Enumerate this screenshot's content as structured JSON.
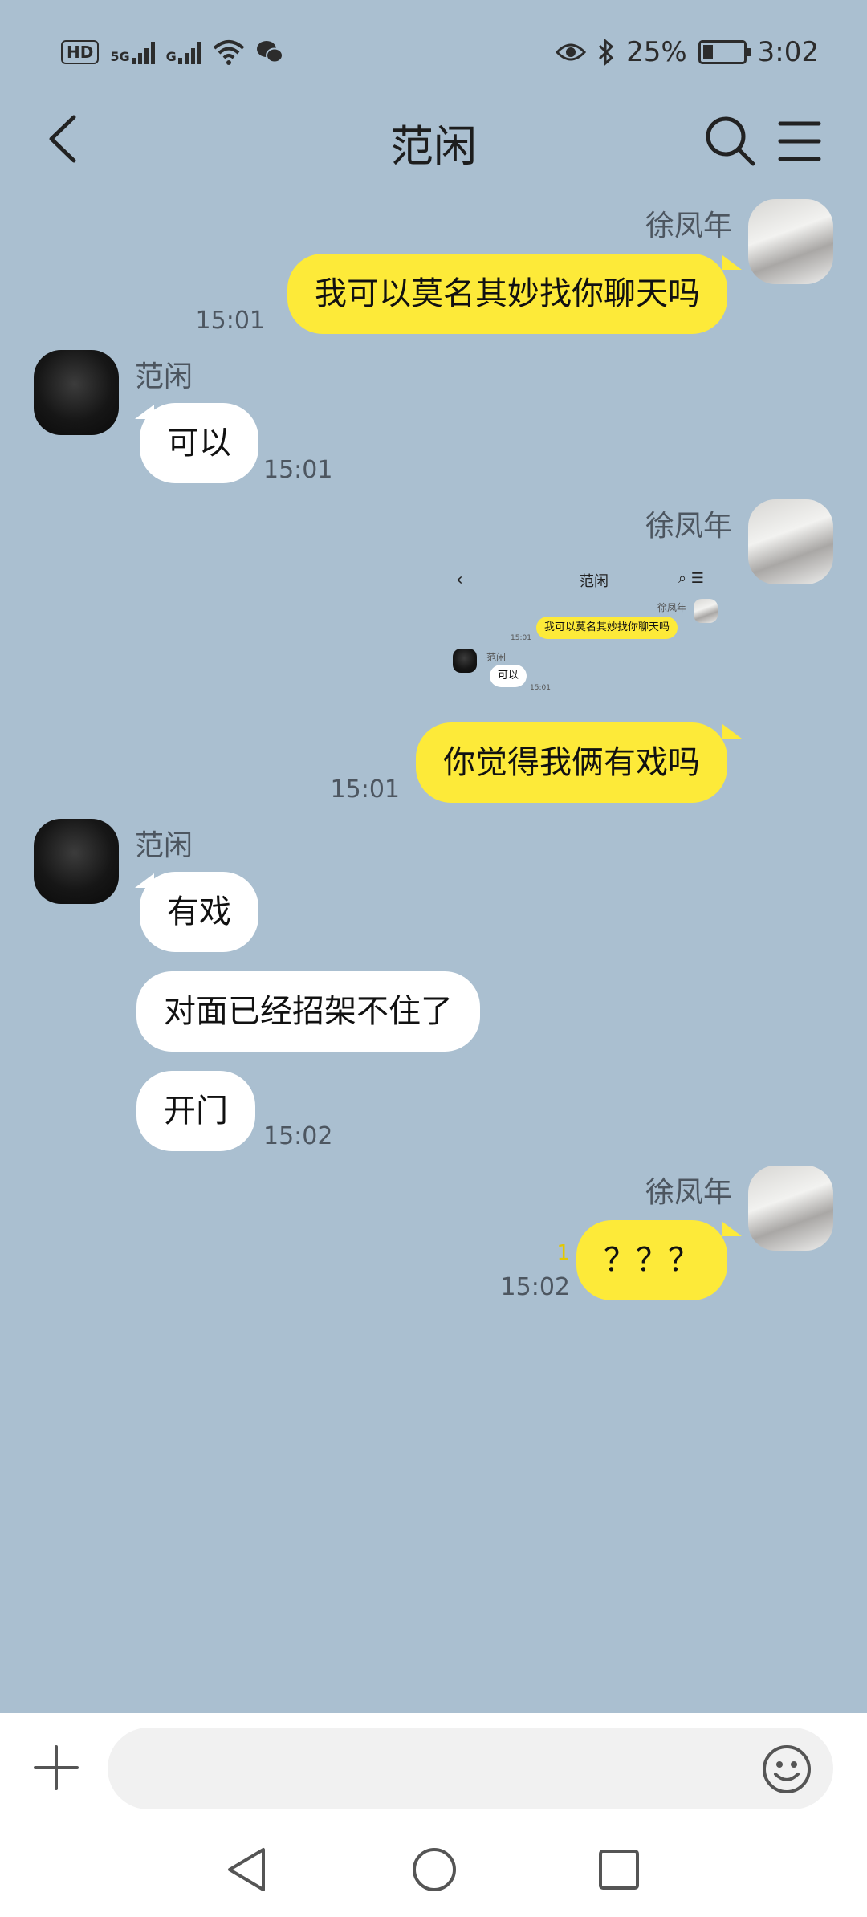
{
  "status": {
    "hd": "HD",
    "sim1": "5G",
    "sim2": "G",
    "battery_pct": "25%",
    "battery_level": 0.25,
    "time": "3:02",
    "icons": [
      "hd-icon",
      "signal-icon",
      "wifi-icon",
      "wechat-icon",
      "eye-icon",
      "bluetooth-icon",
      "battery-icon"
    ]
  },
  "header": {
    "title": "范闲",
    "back_icon": "back-arrow-icon",
    "search_icon": "search-icon",
    "menu_icon": "menu-icon"
  },
  "messages": [
    {
      "sender": "徐凤年",
      "text": "我可以莫名其妙找你聊天吗",
      "time": "15:01"
    },
    {
      "sender": "范闲",
      "text": "可以",
      "time": "15:01"
    },
    {
      "sender": "徐凤年",
      "text": "你觉得我俩有戏吗",
      "time": "15:01"
    },
    {
      "sender": "范闲",
      "texts": [
        "有戏",
        "对面已经招架不住了",
        "开门"
      ],
      "time": "15:02"
    },
    {
      "sender": "徐凤年",
      "text": "？？？",
      "time": "15:02",
      "unread": "1"
    }
  ],
  "shared_screenshot": {
    "title": "范闲",
    "sender_me": "徐凤年",
    "text_me": "我可以莫名其妙找你聊天吗",
    "time_me": "15:01",
    "sender_them": "范闲",
    "text_them": "可以",
    "time_them": "15:01"
  },
  "input": {
    "placeholder": "",
    "plus_icon": "plus-icon",
    "emoji_icon": "emoji-icon"
  },
  "nav": {
    "back_icon": "nav-back-icon",
    "home_icon": "nav-home-icon",
    "recent_icon": "nav-recent-icon"
  },
  "colors": {
    "background": "#aabfd0",
    "my_bubble": "#fdea39",
    "their_bubble": "#ffffff"
  }
}
